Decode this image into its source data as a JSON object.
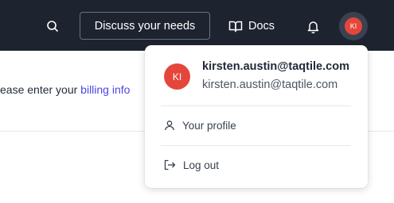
{
  "topbar": {
    "search_icon": "search-icon",
    "discuss_label": "Discuss your needs",
    "docs_label": "Docs",
    "docs_icon": "book-open-icon",
    "bell_icon": "bell-icon",
    "avatar_initials": "KI"
  },
  "content": {
    "text_before": "ease enter your ",
    "link_text": "billing info"
  },
  "dropdown": {
    "avatar_initials": "KI",
    "name": "kirsten.austin@taqtile.com",
    "email": "kirsten.austin@taqtile.com",
    "items": [
      {
        "label": "Your profile",
        "icon": "user-icon"
      },
      {
        "label": "Log out",
        "icon": "logout-icon"
      }
    ]
  },
  "colors": {
    "topbar_bg": "#1e2330",
    "avatar_bg": "#e5463b",
    "link": "#4f46e5"
  }
}
